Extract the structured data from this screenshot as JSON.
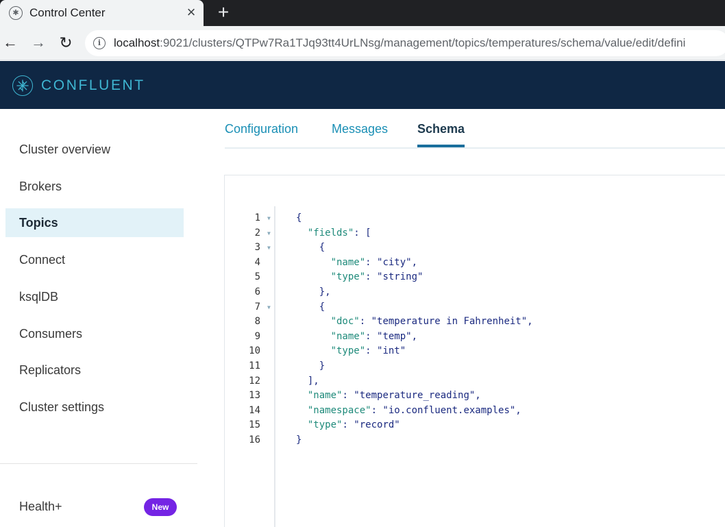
{
  "browser": {
    "tab_title": "Control Center",
    "tab_close": "×",
    "new_tab": "+",
    "url_host": "localhost",
    "url_path": ":9021/clusters/QTPw7Ra1TJq93tt4UrLNsg/management/topics/temperatures/schema/value/edit/defini"
  },
  "header": {
    "brand": "CONFLUENT"
  },
  "sidebar": {
    "items": [
      {
        "label": "Cluster overview"
      },
      {
        "label": "Brokers"
      },
      {
        "label": "Topics"
      },
      {
        "label": "Connect"
      },
      {
        "label": "ksqlDB"
      },
      {
        "label": "Consumers"
      },
      {
        "label": "Replicators"
      },
      {
        "label": "Cluster settings"
      }
    ],
    "active": "Topics",
    "footer": {
      "label": "Health+",
      "badge": "New"
    }
  },
  "tabs": [
    {
      "label": "Configuration"
    },
    {
      "label": "Messages"
    },
    {
      "label": "Schema"
    }
  ],
  "active_tab": "Schema",
  "editor": {
    "line_numbers": [
      "1",
      "2",
      "3",
      "4",
      "5",
      "6",
      "7",
      "8",
      "9",
      "10",
      "11",
      "12",
      "13",
      "14",
      "15",
      "16"
    ],
    "lines": [
      {
        "indent": "",
        "key": "",
        "rest": "{"
      },
      {
        "indent": "  ",
        "key": "\"fields\"",
        "rest": ": ["
      },
      {
        "indent": "    ",
        "key": "",
        "rest": "{"
      },
      {
        "indent": "      ",
        "key": "\"name\"",
        "rest": ": \"city\","
      },
      {
        "indent": "      ",
        "key": "\"type\"",
        "rest": ": \"string\""
      },
      {
        "indent": "    ",
        "key": "",
        "rest": "},"
      },
      {
        "indent": "    ",
        "key": "",
        "rest": "{"
      },
      {
        "indent": "      ",
        "key": "\"doc\"",
        "rest": ": \"temperature in Fahrenheit\","
      },
      {
        "indent": "      ",
        "key": "\"name\"",
        "rest": ": \"temp\","
      },
      {
        "indent": "      ",
        "key": "\"type\"",
        "rest": ": \"int\""
      },
      {
        "indent": "    ",
        "key": "",
        "rest": "}"
      },
      {
        "indent": "  ",
        "key": "",
        "rest": "],"
      },
      {
        "indent": "  ",
        "key": "\"name\"",
        "rest": ": \"temperature_reading\","
      },
      {
        "indent": "  ",
        "key": "\"namespace\"",
        "rest": ": \"io.confluent.examples\","
      },
      {
        "indent": "  ",
        "key": "\"type\"",
        "rest": ": \"record\""
      },
      {
        "indent": "",
        "key": "",
        "rest": "}"
      }
    ],
    "fold_markers": [
      "1",
      "2",
      "3",
      "7"
    ]
  }
}
